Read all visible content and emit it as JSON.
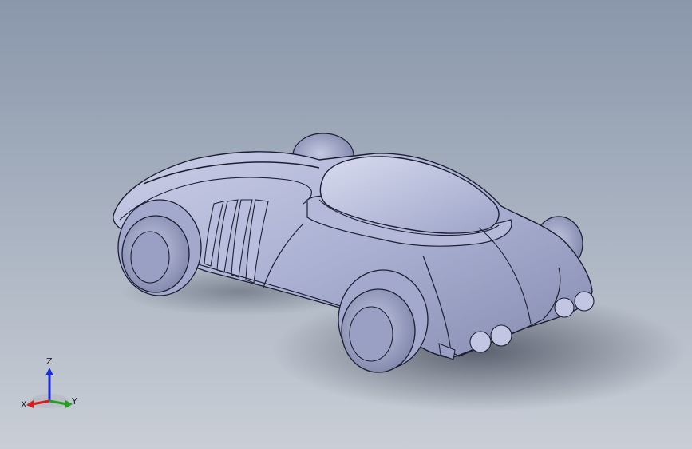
{
  "viewport": {
    "background_top": "#8a97ab",
    "background_bottom": "#c9ced6"
  },
  "model": {
    "body_color": "#aab0d0",
    "edge_color": "#1c1f33"
  },
  "triad": {
    "x_label": "X",
    "y_label": "Y",
    "z_label": "Z",
    "x_color": "#d81d1d",
    "y_color": "#1fa31f",
    "z_color": "#1b2ad6"
  }
}
